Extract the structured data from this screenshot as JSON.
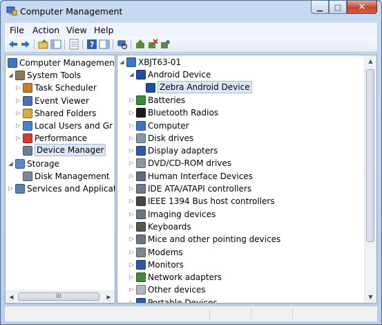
{
  "window": {
    "title": "Computer Management"
  },
  "menu": [
    "File",
    "Action",
    "View",
    "Help"
  ],
  "left_tree": [
    {
      "label": "Computer Management",
      "icon": "computer-management-icon",
      "expander": "",
      "indent": 0
    },
    {
      "label": "System Tools",
      "icon": "system-tools-icon",
      "expander": "expanded",
      "indent": 1
    },
    {
      "label": "Task Scheduler",
      "icon": "clock-icon",
      "expander": "collapsed",
      "indent": 2
    },
    {
      "label": "Event Viewer",
      "icon": "event-viewer-icon",
      "expander": "collapsed",
      "indent": 2
    },
    {
      "label": "Shared Folders",
      "icon": "shared-folder-icon",
      "expander": "collapsed",
      "indent": 2
    },
    {
      "label": "Local Users and Gr",
      "icon": "users-icon",
      "expander": "collapsed",
      "indent": 2
    },
    {
      "label": "Performance",
      "icon": "performance-icon",
      "expander": "collapsed",
      "indent": 2
    },
    {
      "label": "Device Manager",
      "icon": "device-manager-icon",
      "expander": "",
      "indent": 2,
      "selected": true
    },
    {
      "label": "Storage",
      "icon": "storage-icon",
      "expander": "expanded",
      "indent": 1
    },
    {
      "label": "Disk Management",
      "icon": "disk-management-icon",
      "expander": "",
      "indent": 2
    },
    {
      "label": "Services and Applicat",
      "icon": "services-icon",
      "expander": "collapsed",
      "indent": 1
    }
  ],
  "right_tree": [
    {
      "label": "XBJT63-01",
      "icon": "computer-icon",
      "expander": "expanded",
      "indent": 0
    },
    {
      "label": "Android Device",
      "icon": "android-device-icon",
      "expander": "expanded",
      "indent": 1
    },
    {
      "label": "Zebra Android Device",
      "icon": "zebra-device-icon",
      "expander": "",
      "indent": 2,
      "selected": true
    },
    {
      "label": "Batteries",
      "icon": "battery-icon",
      "expander": "collapsed",
      "indent": 1
    },
    {
      "label": "Bluetooth Radios",
      "icon": "bluetooth-icon",
      "expander": "collapsed",
      "indent": 1
    },
    {
      "label": "Computer",
      "icon": "computer-icon",
      "expander": "collapsed",
      "indent": 1
    },
    {
      "label": "Disk drives",
      "icon": "disk-drive-icon",
      "expander": "collapsed",
      "indent": 1
    },
    {
      "label": "Display adapters",
      "icon": "display-adapter-icon",
      "expander": "collapsed",
      "indent": 1
    },
    {
      "label": "DVD/CD-ROM drives",
      "icon": "dvd-icon",
      "expander": "collapsed",
      "indent": 1
    },
    {
      "label": "Human Interface Devices",
      "icon": "hid-icon",
      "expander": "collapsed",
      "indent": 1
    },
    {
      "label": "IDE ATA/ATAPI controllers",
      "icon": "ide-icon",
      "expander": "collapsed",
      "indent": 1
    },
    {
      "label": "IEEE 1394 Bus host controllers",
      "icon": "ieee1394-icon",
      "expander": "collapsed",
      "indent": 1
    },
    {
      "label": "Imaging devices",
      "icon": "imaging-icon",
      "expander": "collapsed",
      "indent": 1
    },
    {
      "label": "Keyboards",
      "icon": "keyboard-icon",
      "expander": "collapsed",
      "indent": 1
    },
    {
      "label": "Mice and other pointing devices",
      "icon": "mouse-icon",
      "expander": "collapsed",
      "indent": 1
    },
    {
      "label": "Modems",
      "icon": "modem-icon",
      "expander": "collapsed",
      "indent": 1
    },
    {
      "label": "Monitors",
      "icon": "monitor-icon",
      "expander": "collapsed",
      "indent": 1
    },
    {
      "label": "Network adapters",
      "icon": "network-adapter-icon",
      "expander": "collapsed",
      "indent": 1
    },
    {
      "label": "Other devices",
      "icon": "other-devices-icon",
      "expander": "collapsed",
      "indent": 1
    },
    {
      "label": "Portable Devices",
      "icon": "portable-devices-icon",
      "expander": "collapsed",
      "indent": 1
    }
  ],
  "scrollbar": {
    "h_thumb_grip": "III"
  }
}
